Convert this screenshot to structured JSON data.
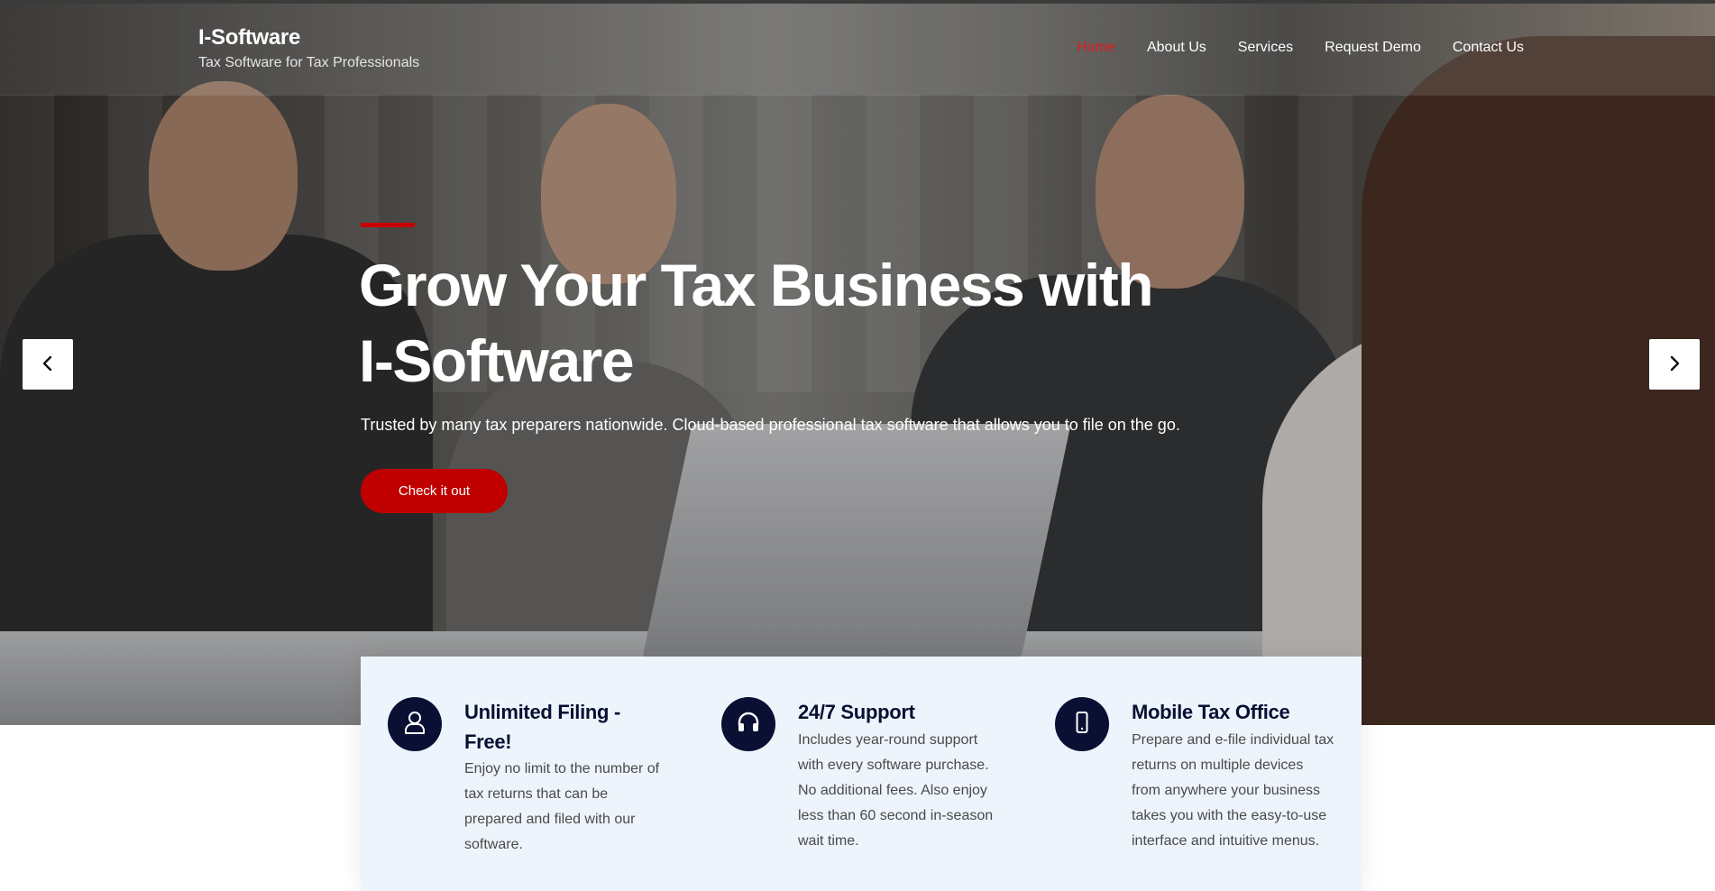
{
  "header": {
    "brand_name": "I-Software",
    "brand_tagline": "Tax Software for Tax Professionals",
    "nav": [
      {
        "label": "Home",
        "active": true
      },
      {
        "label": "About Us",
        "active": false
      },
      {
        "label": "Services",
        "active": false
      },
      {
        "label": "Request Demo",
        "active": false
      },
      {
        "label": "Contact Us",
        "active": false
      }
    ]
  },
  "hero": {
    "title": "Grow Your Tax Business with I-Software",
    "subtitle": "Trusted by many tax preparers nationwide. Cloud-based professional tax software that allows you to file on the go.",
    "cta_label": "Check it out",
    "prev_icon": "chevron-left-icon",
    "next_icon": "chevron-right-icon"
  },
  "features": [
    {
      "icon": "user-icon",
      "title": "Unlimited Filing - Free!",
      "text": "Enjoy no limit to the number of tax returns that can be prepared and filed with our software."
    },
    {
      "icon": "headset-icon",
      "title": "24/7 Support",
      "text": "Includes year-round support with every software purchase. No additional fees. Also enjoy less than 60 second in-season wait time."
    },
    {
      "icon": "mobile-icon",
      "title": "Mobile Tax Office",
      "text": "Prepare and e-file individual tax returns on multiple devices from anywhere your business takes you with the easy-to-use interface and intuitive menus."
    }
  ],
  "colors": {
    "accent": "#c00000",
    "nav_active": "#e21b1b",
    "icon_bg": "#0a1033",
    "card_bg": "#eef4fc"
  }
}
